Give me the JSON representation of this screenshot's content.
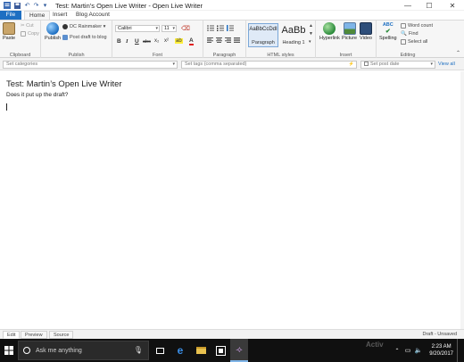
{
  "window": {
    "title": "Test: Martin’s Open Live Writer - Open Live Writer",
    "minimize_glyph": "—",
    "maximize_glyph": "☐",
    "close_glyph": "✕"
  },
  "quick_access": {
    "save_icon": "save-icon",
    "undo_icon": "undo-icon",
    "redo_icon": "redo-icon",
    "dropdown_glyph": "▾"
  },
  "tabs": [
    "File",
    "Home",
    "Insert",
    "Blog Account"
  ],
  "ribbon": {
    "clipboard": {
      "label": "Clipboard",
      "paste": "Paste",
      "cut": "Cut",
      "copy": "Copy"
    },
    "publish": {
      "label": "Publish",
      "publish": "Publish",
      "blog": "DC Rainmaker",
      "post_draft": "Post draft to blog"
    },
    "font": {
      "label": "Font",
      "family": "Calibri",
      "size": "11",
      "dropdown_glyph": "▾",
      "bold": "B",
      "italic": "I",
      "underline": "U",
      "strike": "abc",
      "subscript": "x₂",
      "superscript": "x²",
      "highlight": "ab",
      "color": "A"
    },
    "paragraph": {
      "label": "Paragraph"
    },
    "styles": {
      "label": "HTML styles",
      "paragraph_sample": "AaBbCcDdI",
      "paragraph_name": "Paragraph",
      "heading_sample": "AaBb",
      "heading_name": "Heading 1"
    },
    "insert": {
      "label": "Insert",
      "hyperlink": "Hyperlink",
      "picture": "Picture",
      "video": "Video"
    },
    "editing": {
      "label": "Editing",
      "spelling": "Spelling",
      "spell_mark": "ABC",
      "word_count": "Word count",
      "find": "Find",
      "select_all": "Select all"
    }
  },
  "fields": {
    "categories_placeholder": "Set categories",
    "tags_placeholder": "Set tags (comma separated)",
    "post_date_label": "Set post date",
    "view_all": "View all"
  },
  "post": {
    "title": "Test: Martin’s Open Live Writer",
    "body": "Does it put up the draft?"
  },
  "view_tabs": [
    "Edit",
    "Preview",
    "Source"
  ],
  "status": "Draft - Unsaved",
  "taskbar": {
    "search_placeholder": "Ask me anything",
    "watermark": "Activ",
    "time": "2:23 AM",
    "date": "9/20/2017"
  },
  "colors": {
    "accent": "#1e6fc2",
    "taskbar": "#101010"
  }
}
